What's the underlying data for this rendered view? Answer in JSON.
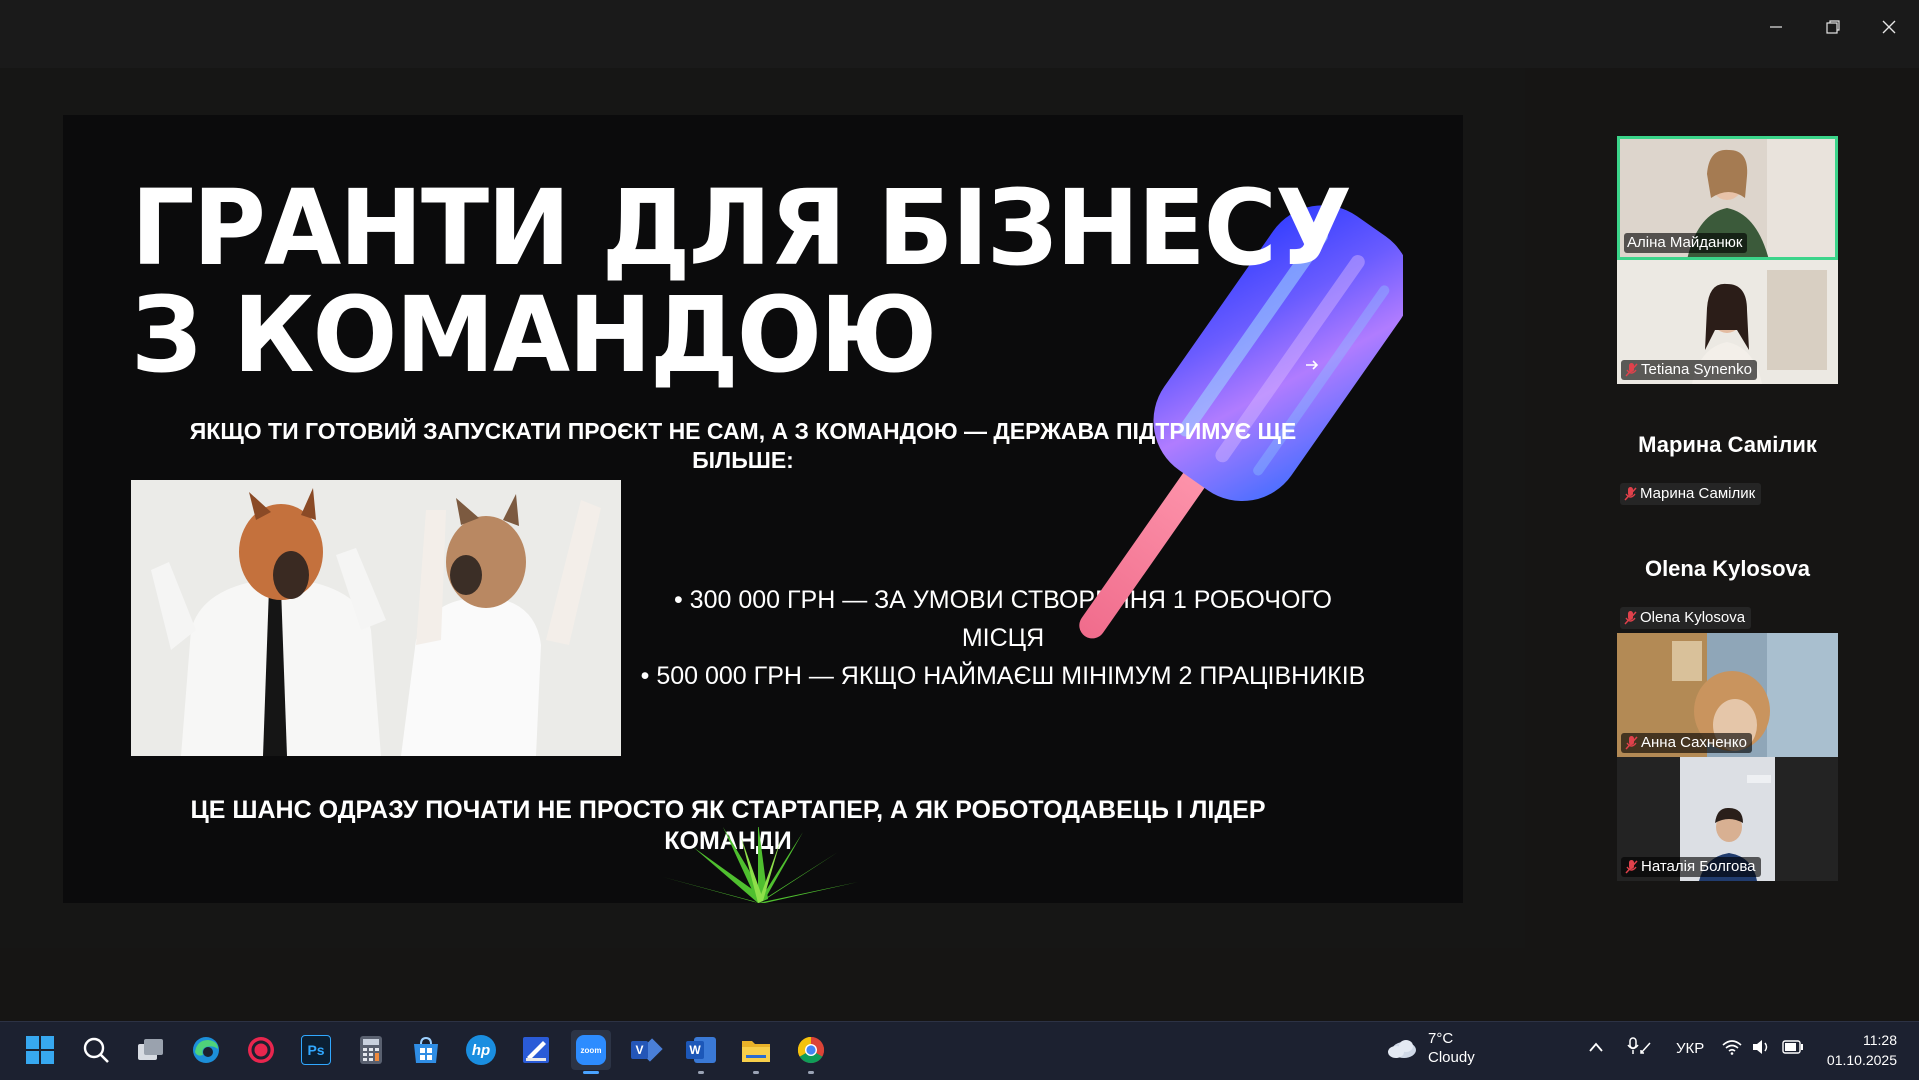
{
  "window": {
    "controls": [
      "minimize-icon",
      "restore-icon",
      "close-icon"
    ]
  },
  "slide": {
    "title_line1": "ГРАНТИ ДЛЯ БІЗНЕСУ",
    "title_line2": "З КОМАНДОЮ",
    "subtitle": "ЯКЩО ТИ ГОТОВИЙ ЗАПУСКАТИ ПРОЄКТ НЕ САМ, А З КОМАНДОЮ — ДЕРЖАВА ПІДТРИМУЄ ЩЕ БІЛЬШЕ:",
    "bullets": [
      "• 300 000 ГРН — ЗА УМОВИ СТВОРЕННЯ 1 РОБОЧОГО МІСЦЯ",
      "• 500 000 ГРН — ЯКЩО НАЙМАЄШ МІНІМУМ 2 ПРАЦІВНИКІВ"
    ],
    "footer": "ЦЕ ШАНС ОДРАЗУ ПОЧАТИ НЕ ПРОСТО ЯК СТАРТАПЕР, А ЯК РОБОТОДАВЕЦЬ І ЛІДЕР КОМАНДИ"
  },
  "participants": [
    {
      "name": "Аліна Майданюк",
      "video": true,
      "active_speaker": true,
      "muted": false
    },
    {
      "name": "Tetiana Synenko",
      "video": true,
      "active_speaker": false,
      "muted": true
    },
    {
      "name": "Марина Самілик",
      "video": false,
      "active_speaker": false,
      "muted": true
    },
    {
      "name": "Olena Kylosova",
      "video": false,
      "active_speaker": false,
      "muted": true
    },
    {
      "name": "Анна Сахненко",
      "video": true,
      "active_speaker": false,
      "muted": true
    },
    {
      "name": "Наталія Болгова",
      "video": true,
      "active_speaker": false,
      "muted": true
    }
  ],
  "taskbar": {
    "apps": [
      "start-icon",
      "search-icon",
      "task-view-icon",
      "edge-icon",
      "record-app-icon",
      "photoshop-icon",
      "calculator-icon",
      "store-icon",
      "hp-icon",
      "print-app-icon",
      "zoom-icon",
      "visio-icon",
      "word-icon",
      "file-explorer-icon",
      "chrome-icon"
    ],
    "photoshop_label": "Ps",
    "hp_label": "hp",
    "zoom_label": "zoom",
    "visio_label": "V",
    "word_label": "W",
    "weather": {
      "temp": "7°C",
      "condition": "Cloudy"
    },
    "language": "УКР",
    "time": "11:28",
    "date": "01.10.2025"
  },
  "colors": {
    "active_speaker_border": "#3bd48a",
    "muted_mic": "#e0414b",
    "taskbar_bg": "#1c2130",
    "zoom_blue": "#2d8cff"
  }
}
